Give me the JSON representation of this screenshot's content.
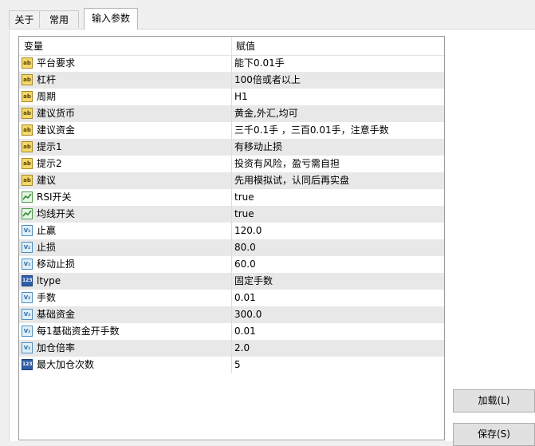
{
  "tabs": [
    {
      "label": "关于"
    },
    {
      "label": "常用"
    },
    {
      "label": "输入参数"
    }
  ],
  "table": {
    "headers": {
      "variable": "变量",
      "value": "赋值"
    },
    "rows": [
      {
        "icon": "ab",
        "name": "平台要求",
        "value": "能下0.01手"
      },
      {
        "icon": "ab",
        "name": "杠杆",
        "value": "100倍或者以上"
      },
      {
        "icon": "ab",
        "name": "周期",
        "value": "H1"
      },
      {
        "icon": "ab",
        "name": "建议货币",
        "value": "黄金,外汇,均可"
      },
      {
        "icon": "ab",
        "name": "建议资金",
        "value": "三千0.1手 ，三百0.01手，注意手数"
      },
      {
        "icon": "ab",
        "name": "提示1",
        "value": "有移动止损"
      },
      {
        "icon": "ab",
        "name": "提示2",
        "value": "投资有风险，盈亏需自担"
      },
      {
        "icon": "ab",
        "name": "建议",
        "value": "先用模拟试，认同后再实盘"
      },
      {
        "icon": "bool",
        "name": "RSI开关",
        "value": "true"
      },
      {
        "icon": "bool",
        "name": "均线开关",
        "value": "true"
      },
      {
        "icon": "double",
        "name": "止赢",
        "value": "120.0"
      },
      {
        "icon": "double",
        "name": "止损",
        "value": "80.0"
      },
      {
        "icon": "double",
        "name": "移动止损",
        "value": "60.0"
      },
      {
        "icon": "int",
        "name": "ltype",
        "value": "固定手数"
      },
      {
        "icon": "double",
        "name": "手数",
        "value": "0.01"
      },
      {
        "icon": "double",
        "name": "基础资金",
        "value": "300.0"
      },
      {
        "icon": "double",
        "name": "每1基础资金开手数",
        "value": "0.01"
      },
      {
        "icon": "double",
        "name": "加仓倍率",
        "value": "2.0"
      },
      {
        "icon": "int",
        "name": "最大加仓次数",
        "value": "5"
      }
    ]
  },
  "buttons": {
    "load": "加载(L)",
    "save": "保存(S)"
  }
}
